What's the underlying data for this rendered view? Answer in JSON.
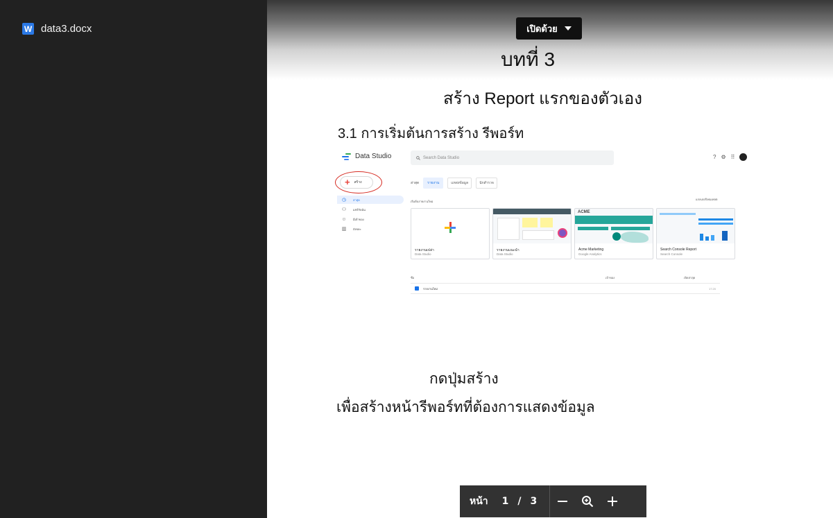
{
  "file": {
    "icon_letter": "W",
    "name": "data3.docx"
  },
  "toolbar": {
    "open_with_label": "เปิดด้วย"
  },
  "document": {
    "chapter": "บทที่ 3",
    "subtitle": "สร้าง Report แรกของตัวเอง",
    "section": "3.1 การเริ่มต้นการสร้าง รีพอร์ท",
    "caption_line1": "กดปุ่มสร้าง",
    "caption_line2": "เพื่อสร้างหน้ารีพอร์ทที่ต้องการแสดงข้อมูล"
  },
  "screenshot": {
    "app_name": "Data Studio",
    "search_placeholder": "Search Data Studio",
    "create_label": "สร้าง",
    "nav": [
      "ล่าสุด",
      "แชร์กับฉัน",
      "มีเจ้าของ",
      "ถังขยะ"
    ],
    "tabs": [
      "ล่าสุด",
      "รายงาน",
      "แหล่งข้อมูล",
      "นักสำรวจ"
    ],
    "recent_label": "เริ่มต้นรายงานใหม่",
    "templates_label": "แกลเลอรีเทมเพลต",
    "cards": [
      {
        "title": "รายงานเปล่า",
        "subtitle": "Data Studio"
      },
      {
        "title": "รายงานแนะนำ",
        "subtitle": "Data Studio"
      },
      {
        "title": "Acme Marketing",
        "subtitle": "Google Analytics"
      },
      {
        "title": "Search Console Report",
        "subtitle": "Search Console"
      }
    ],
    "list_headers": {
      "name": "ชื่อ",
      "owner": "เจ้าของ",
      "opened": "เปิดล่าสุด"
    },
    "rows": [
      {
        "name": "รายงานใหม่",
        "owner": "",
        "time": "17:20"
      }
    ]
  },
  "pager": {
    "label": "หน้า",
    "current": "1",
    "separator": "/",
    "total": "3"
  },
  "colors": {
    "sidebar": "#212121",
    "word_blue": "#2b79e6",
    "pager_bg": "#323232",
    "annotation_red": "#d62b22"
  }
}
